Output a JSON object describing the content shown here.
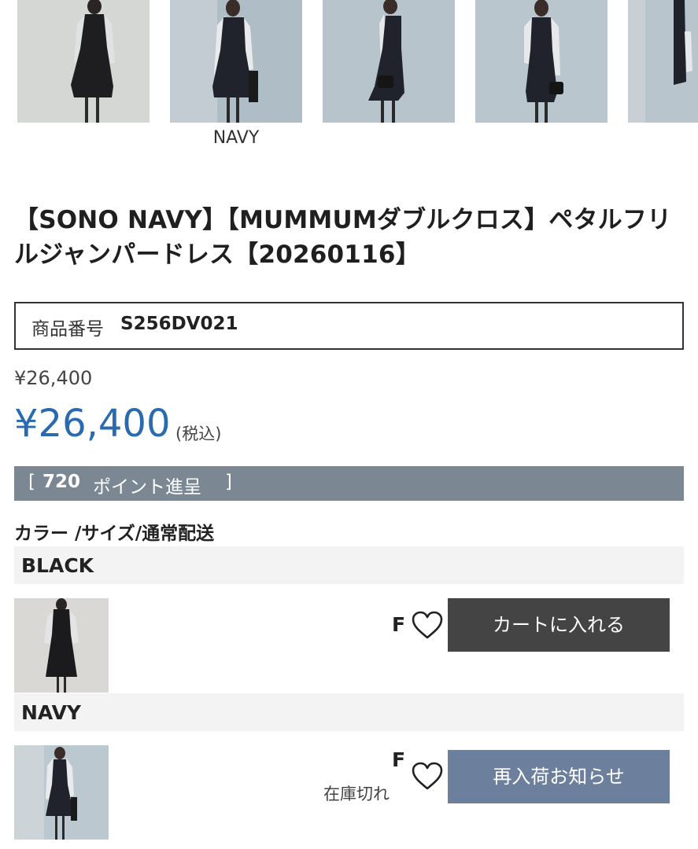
{
  "gallery": {
    "thumbnails": [
      {
        "alt": "black-dress-front"
      },
      {
        "alt": "navy-dress-front"
      },
      {
        "alt": "navy-dress-side"
      },
      {
        "alt": "navy-dress-back"
      },
      {
        "alt": "navy-dress-partial"
      }
    ],
    "selected_caption": "NAVY"
  },
  "product": {
    "title": "【SONO NAVY】【MUMMUMダブルクロス】ペタルフリルジャンパードレス【20260116】",
    "sku_label": "商品番号",
    "sku_value": "S256DV021",
    "list_price": "¥26,400",
    "sale_price": "¥26,400",
    "tax_note": "(税込)",
    "points": {
      "open": "[",
      "value": "720",
      "text": "ポイント進呈",
      "close": "]"
    }
  },
  "variants_header": "カラー /サイズ/通常配送",
  "variants": [
    {
      "color": "BLACK",
      "size": "F",
      "stock": "",
      "button": "カートに入れる"
    },
    {
      "color": "NAVY",
      "size": "F",
      "stock": "在庫切れ",
      "button": "再入荷お知らせ"
    }
  ],
  "colors": {
    "price_blue": "#2a6bb0",
    "points_bar": "#7b8793",
    "cart_button": "#444444",
    "notify_button": "#6c7f9d",
    "row_bg": "#f3f3f3"
  }
}
